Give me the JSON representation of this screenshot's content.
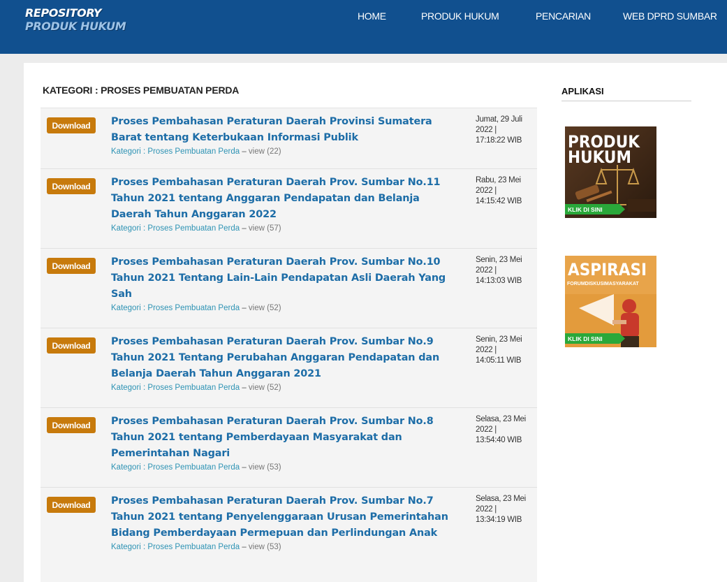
{
  "logo": {
    "line1": "REPOSITORY",
    "line2": "PRODUK HUKUM"
  },
  "nav": [
    "HOME",
    "PRODUK HUKUM",
    "PENCARIAN",
    "WEB DPRD SUMBAR"
  ],
  "category_title": "KATEGORI : PROSES PEMBUATAN PERDA",
  "download_label": "Download",
  "items": [
    {
      "title": "Proses Pembahasan Peraturan Daerah Provinsi Sumatera Barat tentang Keterbukaan Informasi Publik",
      "category": "Kategori : Proses Pembuatan Perda",
      "sep": "–",
      "views": "view (22)",
      "date": [
        "Jumat, 29 Juli",
        "2022 |",
        "17:18:22 WIB"
      ]
    },
    {
      "title": "Proses Pembahasan Peraturan Daerah Prov. Sumbar No.11 Tahun 2021 tentang Anggaran Pendapatan dan Belanja Daerah Tahun Anggaran 2022",
      "category": "Kategori : Proses Pembuatan Perda",
      "sep": "–",
      "views": "view (57)",
      "date": [
        "Rabu, 23 Mei",
        "2022 |",
        "14:15:42 WIB"
      ]
    },
    {
      "title": "Proses Pembahasan Peraturan Daerah Prov. Sumbar No.10 Tahun 2021 Tentang Lain-Lain Pendapatan Asli Daerah Yang Sah",
      "category": "Kategori : Proses Pembuatan Perda",
      "sep": "–",
      "views": "view (52)",
      "date": [
        "Senin, 23 Mei",
        "2022 |",
        "14:13:03 WIB"
      ]
    },
    {
      "title": "Proses Pembahasan Peraturan Daerah Prov. Sumbar No.9 Tahun 2021 Tentang Perubahan Anggaran Pendapatan dan Belanja Daerah Tahun Anggaran 2021",
      "category": "Kategori : Proses Pembuatan Perda",
      "sep": "–",
      "views": "view (52)",
      "date": [
        "Senin, 23 Mei",
        "2022 |",
        "14:05:11 WIB"
      ]
    },
    {
      "title": "Proses Pembahasan Peraturan Daerah Prov. Sumbar No.8 Tahun 2021 tentang Pemberdayaan Masyarakat dan Pemerintahan Nagari",
      "category": "Kategori : Proses Pembuatan Perda",
      "sep": "–",
      "views": "view (53)",
      "date": [
        "Selasa, 23 Mei",
        "2022 |",
        "13:54:40 WIB"
      ]
    },
    {
      "title": "Proses Pembahasan Peraturan Daerah Prov. Sumbar No.7 Tahun 2021 tentang Penyelenggaraan Urusan Pemerintahan Bidang Pemberdayaan Permepuan dan Perlindungan Anak",
      "category": "Kategori : Proses Pembuatan Perda",
      "sep": "–",
      "views": "view (53)",
      "date": [
        "Selasa, 23 Mei",
        "2022 |",
        "13:34:19 WIB"
      ]
    }
  ],
  "sidebar": {
    "title": "APLIKASI",
    "banners": [
      {
        "line1": "PRODUK",
        "line2": "HUKUM",
        "cta": "KLIK DI SINI"
      },
      {
        "line1": "ASPIRASI",
        "line2": "FORUMDISKUSIMASYARAKAT",
        "cta": "KLIK DI SINI"
      }
    ]
  },
  "colors": {
    "header": "#11508f",
    "link": "#1d6da7",
    "download": "#c77a0c"
  }
}
